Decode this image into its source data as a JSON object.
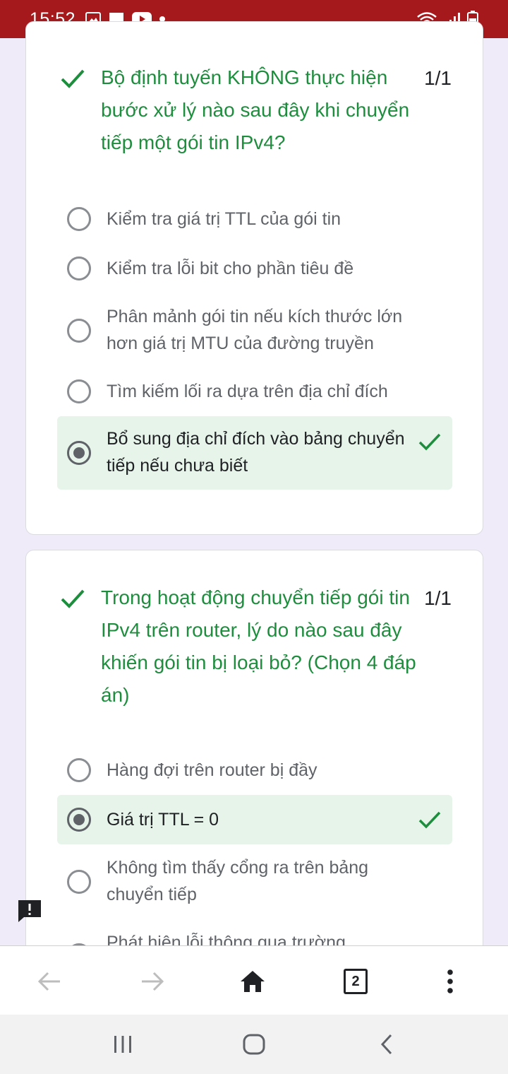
{
  "status_bar": {
    "time": "15:52",
    "left_icons": [
      "image-icon",
      "message-icon",
      "youtube-icon",
      "dot-icon"
    ],
    "right_icons": [
      "wifi-icon",
      "signal-icon",
      "battery-icon"
    ]
  },
  "questions": [
    {
      "title": "Bộ định tuyến KHÔNG thực hiện bước xử lý nào sau đây khi chuyển tiếp một gói tin IPv4?",
      "score": "1/1",
      "options": [
        {
          "label": "Kiểm tra giá trị TTL của gói tin",
          "selected": false
        },
        {
          "label": "Kiểm tra lỗi bit cho phần tiêu đề",
          "selected": false
        },
        {
          "label": "Phân mảnh gói tin nếu kích thước lớn hơn giá trị MTU của đường truyền",
          "selected": false
        },
        {
          "label": "Tìm kiếm lối ra dựa trên địa chỉ đích",
          "selected": false
        },
        {
          "label": "Bổ sung địa chỉ đích vào bảng chuyển tiếp nếu chưa biết",
          "selected": true
        }
      ]
    },
    {
      "title": "Trong hoạt động chuyển tiếp gói tin IPv4 trên router, lý do nào sau đây khiến gói tin bị loại bỏ? (Chọn 4 đáp án)",
      "score": "1/1",
      "options": [
        {
          "label": "Hàng đợi trên router bị đầy",
          "selected": false
        },
        {
          "label": "Giá trị TTL = 0",
          "selected": true
        },
        {
          "label": "Không tìm thấy cổng ra trên bảng chuyển tiếp",
          "selected": false
        },
        {
          "label": "Phát hiện lỗi thông qua trường",
          "selected": false
        }
      ]
    }
  ],
  "browser_bar": {
    "tab_count": "2",
    "icons": [
      "back-arrow-icon",
      "forward-arrow-icon",
      "home-icon",
      "tabs-icon",
      "more-vert-icon"
    ]
  },
  "colors": {
    "status_bar": "#a5191c",
    "correct_green": "#1e8e3e",
    "selected_bg": "#e6f4ea",
    "page_bg": "#f0ebf8"
  }
}
